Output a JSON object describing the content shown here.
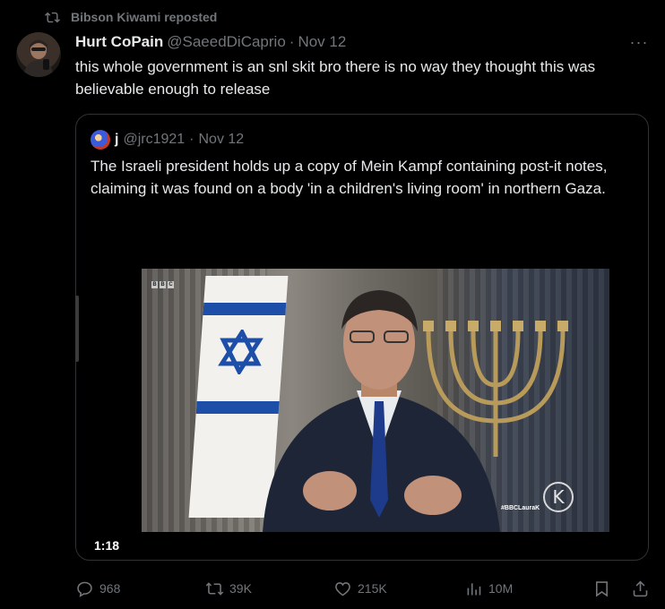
{
  "repost": {
    "icon": "repost-icon",
    "label": "Bibson Kiwami reposted"
  },
  "tweet": {
    "author_name": "Hurt CoPain",
    "author_handle": "@SaeedDiCaprio",
    "separator": "·",
    "date": "Nov 12",
    "more_label": "···",
    "text": "this whole government is an snl skit bro there is no way they thought this was believable enough to release"
  },
  "quote": {
    "author_name": "j",
    "author_handle": "@jrc1921",
    "separator": "·",
    "date": "Nov 12",
    "text": "The Israeli president holds up a copy of Mein Kampf containing post-it notes, claiming it was found on a body 'in a children's living room' in northern Gaza.",
    "video": {
      "duration": "1:18",
      "channel_letters": [
        "B",
        "B",
        "C"
      ],
      "watermark_letter": "K",
      "watermark_tag": "#BBCLauraK"
    }
  },
  "actions": {
    "replies": "968",
    "reposts": "39K",
    "likes": "215K",
    "views": "10M"
  },
  "colors": {
    "background": "#000000",
    "text_primary": "#e7e9ea",
    "text_secondary": "#71767b",
    "border": "#2f3336"
  }
}
